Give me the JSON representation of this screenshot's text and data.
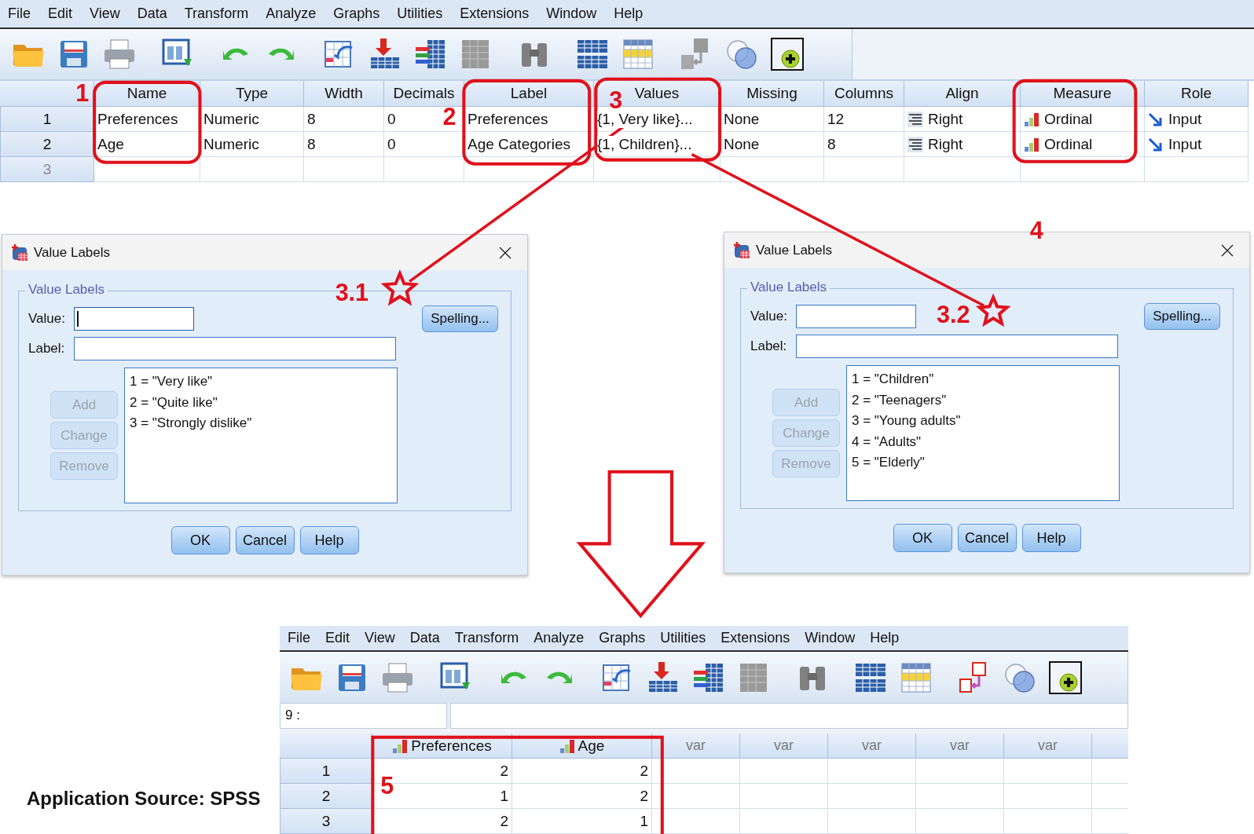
{
  "variable_view": {
    "menu": [
      "File",
      "Edit",
      "View",
      "Data",
      "Transform",
      "Analyze",
      "Graphs",
      "Utilities",
      "Extensions",
      "Window",
      "Help"
    ],
    "value_labels_disabled": true,
    "columns": [
      {
        "label": "Name",
        "kind": "text"
      },
      {
        "label": "Type",
        "kind": "text"
      },
      {
        "label": "Width",
        "kind": "text"
      },
      {
        "label": "Decimals",
        "kind": "text"
      },
      {
        "label": "Label",
        "kind": "text"
      },
      {
        "label": "Values",
        "kind": "text"
      },
      {
        "label": "Missing",
        "kind": "text"
      },
      {
        "label": "Columns",
        "kind": "text"
      },
      {
        "label": "Align",
        "kind": "align"
      },
      {
        "label": "Measure",
        "kind": "measure"
      },
      {
        "label": "Role",
        "kind": "role"
      }
    ],
    "rows": [
      {
        "number": "1",
        "cells": [
          "Preferences",
          "Numeric",
          "8",
          "0",
          "Preferences",
          "{1, Very like}...",
          "None",
          "12",
          "Right",
          "Ordinal",
          "Input"
        ]
      },
      {
        "number": "2",
        "cells": [
          "Age",
          "Numeric",
          "8",
          "0",
          "Age Categories",
          "{1, Children}...",
          "None",
          "8",
          "Right",
          "Ordinal",
          "Input"
        ]
      },
      {
        "number": "3"
      }
    ]
  },
  "dialogs": [
    {
      "title": "Value Labels",
      "group_title": "Value Labels",
      "value_label": "Value:",
      "value_focused": true,
      "label_label": "Label:",
      "spelling_button": {
        "label": "Spelling...",
        "disabled": false
      },
      "side_buttons": [
        {
          "label": "Add",
          "disabled": true
        },
        {
          "label": "Change",
          "disabled": true
        },
        {
          "label": "Remove",
          "disabled": true
        }
      ],
      "entries": [
        "1 = \"Very like\"",
        "2 = \"Quite like\"",
        "3 = \"Strongly dislike\""
      ],
      "buttons": [
        {
          "label": "OK",
          "disabled": false
        },
        {
          "label": "Cancel",
          "disabled": false
        },
        {
          "label": "Help",
          "disabled": false
        }
      ]
    },
    {
      "title": "Value Labels",
      "group_title": "Value Labels",
      "value_label": "Value:",
      "value_focused": false,
      "label_label": "Label:",
      "spelling_button": {
        "label": "Spelling...",
        "disabled": false
      },
      "side_buttons": [
        {
          "label": "Add",
          "disabled": true
        },
        {
          "label": "Change",
          "disabled": true
        },
        {
          "label": "Remove",
          "disabled": true
        }
      ],
      "entries": [
        "1 = \"Children\"",
        "2 = \"Teenagers\"",
        "3 = \"Young adults\"",
        "4 = \"Adults\"",
        "5 = \"Elderly\""
      ],
      "buttons": [
        {
          "label": "OK",
          "disabled": false
        },
        {
          "label": "Cancel",
          "disabled": false
        },
        {
          "label": "Help",
          "disabled": false
        }
      ]
    }
  ],
  "data_view": {
    "menu": [
      "File",
      "Edit",
      "View",
      "Data",
      "Transform",
      "Analyze",
      "Graphs",
      "Utilities",
      "Extensions",
      "Window",
      "Help"
    ],
    "value_labels_disabled": false,
    "cell_reference": "9 :",
    "columns": [
      {
        "label": "Preferences",
        "kind": "variable"
      },
      {
        "label": "Age",
        "kind": "variable"
      },
      {
        "label": "var",
        "kind": "placeholder"
      },
      {
        "label": "var",
        "kind": "placeholder"
      },
      {
        "label": "var",
        "kind": "placeholder"
      },
      {
        "label": "var",
        "kind": "placeholder"
      },
      {
        "label": "var",
        "kind": "placeholder"
      }
    ],
    "rows": [
      {
        "number": "1",
        "values": [
          "2",
          "2"
        ]
      },
      {
        "number": "2",
        "values": [
          "1",
          "2"
        ]
      },
      {
        "number": "3",
        "values": [
          "2",
          "1"
        ]
      }
    ]
  },
  "annotations": [
    {
      "label": "1"
    },
    {
      "label": "2"
    },
    {
      "label": "3"
    },
    {
      "label": "3.1"
    },
    {
      "label": "3.2"
    },
    {
      "label": "4"
    },
    {
      "label": "5"
    }
  ],
  "caption": "Application Source: SPSS"
}
